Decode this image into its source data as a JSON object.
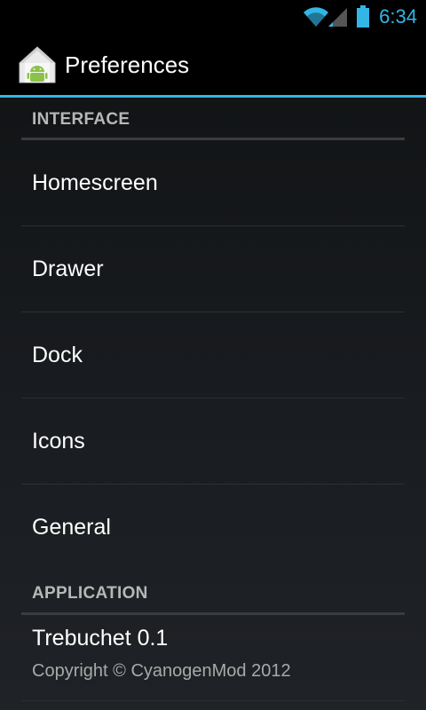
{
  "status_bar": {
    "time": "6:34",
    "icons": [
      "wifi-icon",
      "signal-icon",
      "battery-icon"
    ]
  },
  "action_bar": {
    "title": "Preferences",
    "app_icon": "android-home-icon"
  },
  "categories": {
    "interface": "INTERFACE",
    "application": "APPLICATION"
  },
  "items": {
    "homescreen": "Homescreen",
    "drawer": "Drawer",
    "dock": "Dock",
    "icons": "Icons",
    "general": "General",
    "about_title": "Trebuchet 0.1",
    "about_summary": "Copyright © CyanogenMod 2012"
  },
  "colors": {
    "accent": "#33b5e5",
    "background": "#000000",
    "category_text": "#b7b7b7"
  }
}
